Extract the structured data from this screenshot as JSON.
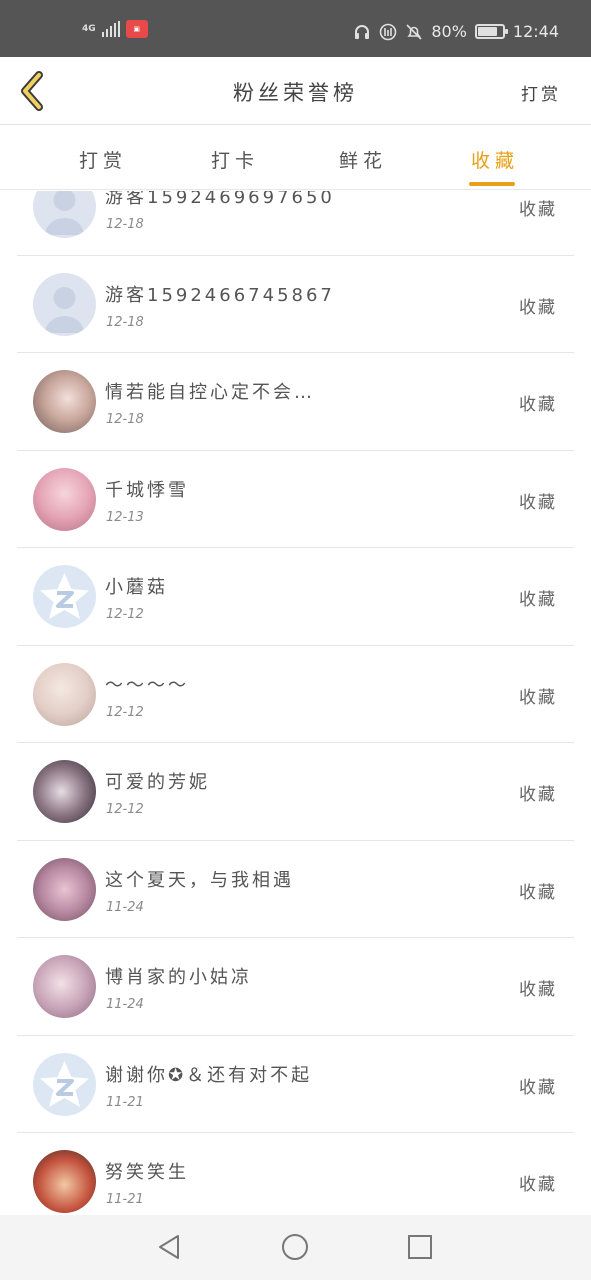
{
  "status_bar": {
    "network": "4G",
    "app_badge_icon": "app-notification-icon",
    "icons": [
      "headset-icon",
      "hd-call-icon",
      "bell-muted-icon"
    ],
    "battery_percent": "80%",
    "battery_level": 0.8,
    "time": "12:44"
  },
  "header": {
    "title": "粉丝荣誉榜",
    "right_link": "打赏"
  },
  "tabs": [
    {
      "label": "打赏",
      "active": false
    },
    {
      "label": "打卡",
      "active": false
    },
    {
      "label": "鲜花",
      "active": false
    },
    {
      "label": "收藏",
      "active": true
    }
  ],
  "accent_color": "#e8a019",
  "list": [
    {
      "name": "游客1592469697650",
      "date": "12-18",
      "action": "收藏",
      "avatar": "guest-avatar-icon"
    },
    {
      "name": "游客1592466745867",
      "date": "12-18",
      "action": "收藏",
      "avatar": "guest-avatar-icon"
    },
    {
      "name": "情若能自控心定不会…",
      "date": "12-18",
      "action": "收藏",
      "avatar": "photo-avatar"
    },
    {
      "name": "千城悸雪",
      "date": "12-13",
      "action": "收藏",
      "avatar": "photo-avatar"
    },
    {
      "name": "小蘑菇",
      "date": "12-12",
      "action": "收藏",
      "avatar": "qq-star-avatar-icon"
    },
    {
      "name": "～～～～",
      "date": "12-12",
      "action": "收藏",
      "avatar": "photo-avatar"
    },
    {
      "name": "可爱的芳妮",
      "date": "12-12",
      "action": "收藏",
      "avatar": "photo-avatar"
    },
    {
      "name": "这个夏天，与我相遇",
      "date": "11-24",
      "action": "收藏",
      "avatar": "photo-avatar"
    },
    {
      "name": "博肖家的小姑凉",
      "date": "11-24",
      "action": "收藏",
      "avatar": "photo-avatar"
    },
    {
      "name": "谢谢你✪＆还有对不起",
      "date": "11-21",
      "action": "收藏",
      "avatar": "qq-star-avatar-icon"
    },
    {
      "name": "努笑笑生",
      "date": "11-21",
      "action": "收藏",
      "avatar": "photo-avatar"
    }
  ],
  "nav_bar": [
    "back-triangle-icon",
    "home-circle-icon",
    "recents-square-icon"
  ]
}
